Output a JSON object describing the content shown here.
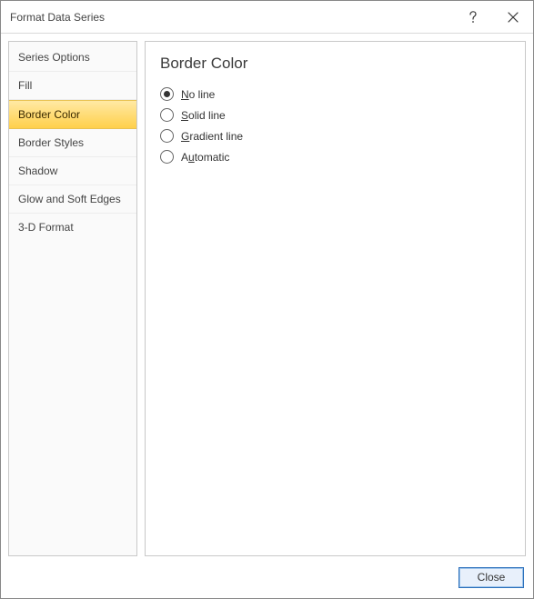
{
  "window": {
    "title": "Format Data Series"
  },
  "sidebar": {
    "items": [
      {
        "label": "Series Options",
        "selected": false
      },
      {
        "label": "Fill",
        "selected": false
      },
      {
        "label": "Border Color",
        "selected": true
      },
      {
        "label": "Border Styles",
        "selected": false
      },
      {
        "label": "Shadow",
        "selected": false
      },
      {
        "label": "Glow and Soft Edges",
        "selected": false
      },
      {
        "label": "3-D Format",
        "selected": false
      }
    ]
  },
  "panel": {
    "heading": "Border Color",
    "options": [
      {
        "key": "no-line",
        "pre": "",
        "accel": "N",
        "post": "o line",
        "checked": true
      },
      {
        "key": "solid-line",
        "pre": "",
        "accel": "S",
        "post": "olid line",
        "checked": false
      },
      {
        "key": "gradient-line",
        "pre": "",
        "accel": "G",
        "post": "radient line",
        "checked": false
      },
      {
        "key": "automatic",
        "pre": "A",
        "accel": "u",
        "post": "tomatic",
        "checked": false
      }
    ]
  },
  "footer": {
    "close_label": "Close"
  }
}
